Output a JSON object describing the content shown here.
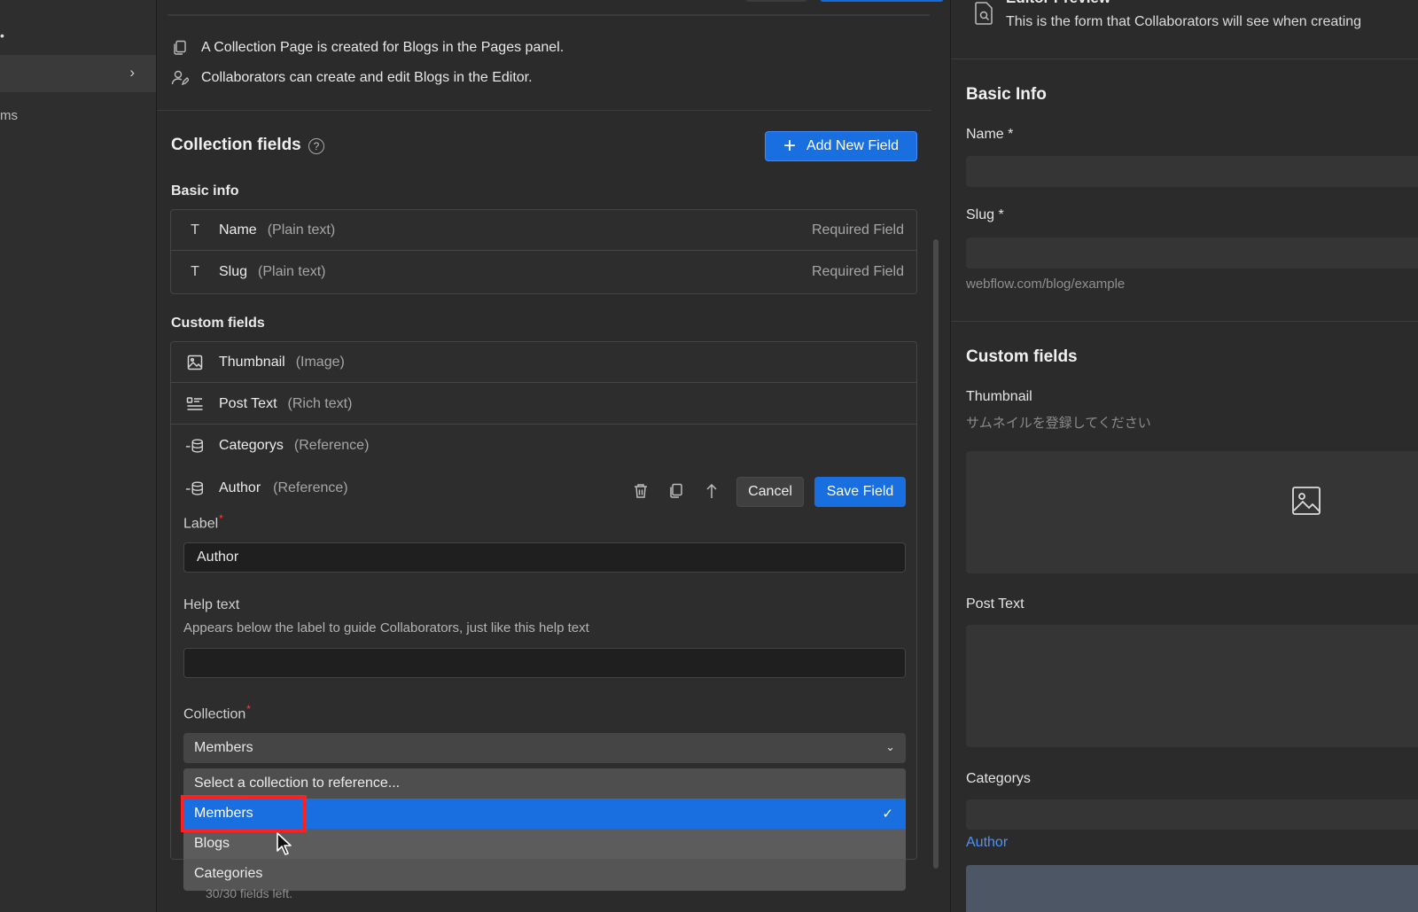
{
  "sidebar": {
    "dot": "•",
    "row_chevron": "›",
    "items_partial": "ms"
  },
  "info": {
    "line1": "A Collection Page is created for Blogs in the Pages panel.",
    "line2": "Collaborators can create and edit Blogs in the Editor."
  },
  "collection_fields": {
    "title": "Collection fields",
    "help_icon": "?",
    "add_button": "Add New Field",
    "add_icon": "+"
  },
  "basic_info": {
    "label": "Basic info",
    "fields": [
      {
        "icon": "text-icon",
        "glyph": "T",
        "name": "Name",
        "type": "(Plain text)",
        "status": "Required Field"
      },
      {
        "icon": "text-icon",
        "glyph": "T",
        "name": "Slug",
        "type": "(Plain text)",
        "status": "Required Field"
      }
    ]
  },
  "custom_fields": {
    "label": "Custom fields",
    "fields": [
      {
        "icon": "image-icon",
        "name": "Thumbnail",
        "type": "(Image)"
      },
      {
        "icon": "rich-text-icon",
        "name": "Post Text",
        "type": "(Rich text)"
      },
      {
        "icon": "reference-icon",
        "name": "Categorys",
        "type": "(Reference)"
      }
    ]
  },
  "editing": {
    "name": "Author",
    "type": "(Reference)",
    "cancel": "Cancel",
    "save": "Save Field",
    "label_label": "Label",
    "label_value": "Author",
    "help_label": "Help text",
    "help_desc": "Appears below the label to guide Collaborators, just like this help text",
    "help_value": "",
    "collection_label": "Collection",
    "collection_value": "Members",
    "required_mark": "*",
    "select_chevron": "⌄"
  },
  "dropdown": {
    "header": "Select a collection to reference...",
    "options": [
      "Members",
      "Blogs",
      "Categories"
    ],
    "selected": "Members",
    "check": "✓"
  },
  "scroll_hint": "30/30 fields left.",
  "preview": {
    "title": "Editor Preview",
    "desc": "This is the form that Collaborators will see when creating",
    "basic_info": "Basic Info",
    "name_label": "Name *",
    "slug_label": "Slug *",
    "slug_hint": "webflow.com/blog/example",
    "custom_fields": "Custom fields",
    "thumbnail_label": "Thumbnail",
    "thumbnail_help": "サムネイルを登録してください",
    "post_text_label": "Post Text",
    "categorys_label": "Categorys",
    "author_label": "Author"
  },
  "colors": {
    "accent": "#1a6fe0",
    "highlight": "#ff2020",
    "author_label": "#4d95f5"
  }
}
